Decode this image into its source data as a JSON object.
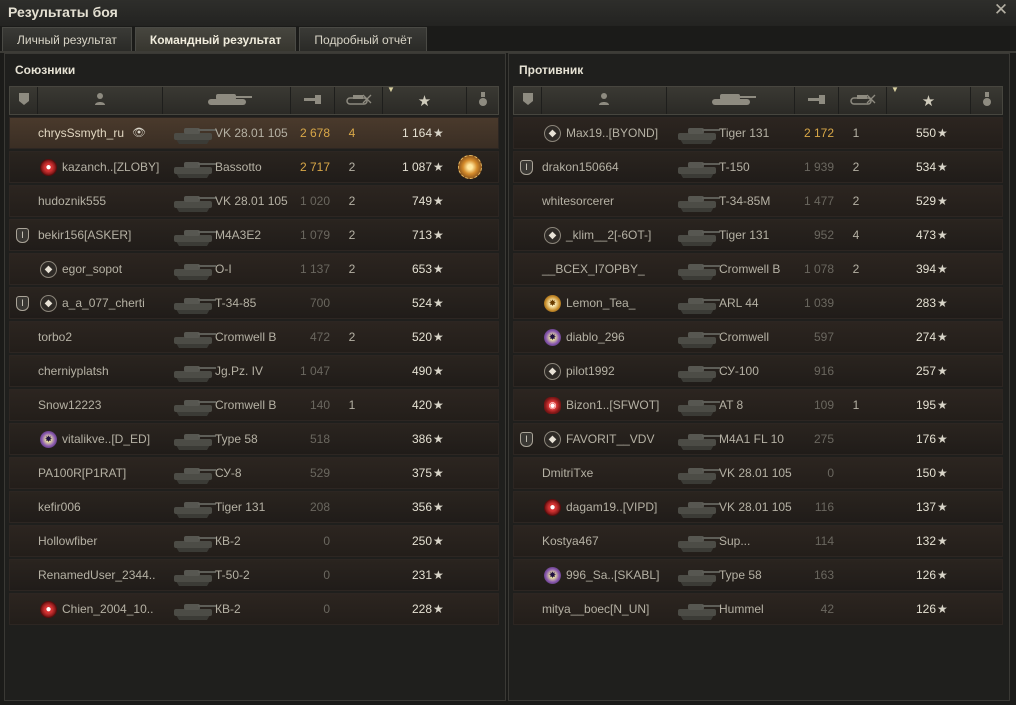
{
  "window": {
    "title": "Результаты боя",
    "close_icon": "close-icon"
  },
  "tabs": [
    {
      "label": "Личный результат",
      "active": false
    },
    {
      "label": "Командный результат",
      "active": true
    },
    {
      "label": "Подробный отчёт",
      "active": false
    }
  ],
  "columns": [
    "platoon",
    "player",
    "vehicle",
    "damage",
    "kills",
    "xp",
    "medals"
  ],
  "allies": {
    "title": "Союзники",
    "rows": [
      {
        "platoon": "",
        "badge": "",
        "name": "chrysSsmyth_ru",
        "vehicle": "VK 28.01 105",
        "damage": "2 678",
        "kills": "4",
        "xp": "1 164",
        "me": true,
        "medal": false
      },
      {
        "platoon": "",
        "badge": "red",
        "name": "kazanch..[ZLOBY]",
        "vehicle": "Bassotto",
        "damage": "2 717",
        "kills": "2",
        "xp": "1 087",
        "me": false,
        "medal": true
      },
      {
        "platoon": "",
        "badge": "",
        "name": "hudoznik555",
        "vehicle": "VK 28.01 105",
        "damage": "1 020",
        "kills": "2",
        "xp": "749",
        "me": false,
        "medal": false
      },
      {
        "platoon": "I",
        "badge": "",
        "name": "bekir156[ASKER]",
        "vehicle": "M4A3E2",
        "damage": "1 079",
        "kills": "2",
        "xp": "713",
        "me": false,
        "medal": false
      },
      {
        "platoon": "",
        "badge": "diamond",
        "name": "egor_sopot",
        "vehicle": "O-I",
        "damage": "1 137",
        "kills": "2",
        "xp": "653",
        "me": false,
        "medal": false
      },
      {
        "platoon": "I",
        "badge": "diamond",
        "name": "a_a_077_cherti",
        "vehicle": "T-34-85",
        "damage": "700",
        "kills": "",
        "xp": "524",
        "me": false,
        "medal": false
      },
      {
        "platoon": "",
        "badge": "",
        "name": "torbo2",
        "vehicle": "Cromwell B",
        "damage": "472",
        "kills": "2",
        "xp": "520",
        "me": false,
        "medal": false
      },
      {
        "platoon": "",
        "badge": "",
        "name": "cherniyplatsh",
        "vehicle": "Jg.Pz. IV",
        "damage": "1 047",
        "kills": "",
        "xp": "490",
        "me": false,
        "medal": false
      },
      {
        "platoon": "",
        "badge": "",
        "name": "Snow12223",
        "vehicle": "Cromwell B",
        "damage": "140",
        "kills": "1",
        "xp": "420",
        "me": false,
        "medal": false
      },
      {
        "platoon": "",
        "badge": "blue2",
        "name": "vitalikve..[D_ED]",
        "vehicle": "Type 58",
        "damage": "518",
        "kills": "",
        "xp": "386",
        "me": false,
        "medal": false
      },
      {
        "platoon": "",
        "badge": "",
        "name": "PA100R[P1RAT]",
        "vehicle": "СУ-8",
        "damage": "529",
        "kills": "",
        "xp": "375",
        "me": false,
        "medal": false
      },
      {
        "platoon": "",
        "badge": "",
        "name": "kefir006",
        "vehicle": "Tiger 131",
        "damage": "208",
        "kills": "",
        "xp": "356",
        "me": false,
        "medal": false
      },
      {
        "platoon": "",
        "badge": "",
        "name": "Hollowfiber",
        "vehicle": "КВ-2",
        "damage": "0",
        "kills": "",
        "xp": "250",
        "me": false,
        "medal": false
      },
      {
        "platoon": "",
        "badge": "",
        "name": "RenamedUser_2344..",
        "vehicle": "T-50-2",
        "damage": "0",
        "kills": "",
        "xp": "231",
        "me": false,
        "medal": false
      },
      {
        "platoon": "",
        "badge": "red",
        "name": "Chien_2004_10..",
        "vehicle": "КВ-2",
        "damage": "0",
        "kills": "",
        "xp": "228",
        "me": false,
        "medal": false
      }
    ]
  },
  "enemies": {
    "title": "Противник",
    "rows": [
      {
        "platoon": "",
        "badge": "diamond",
        "name": "Max19..[BYOND]",
        "vehicle": "Tiger 131",
        "damage": "2 172",
        "kills": "1",
        "xp": "550"
      },
      {
        "platoon": "I",
        "badge": "",
        "name": "drakon150664",
        "vehicle": "T-150",
        "damage": "1 939",
        "kills": "2",
        "xp": "534"
      },
      {
        "platoon": "",
        "badge": "",
        "name": "whitesorcerer",
        "vehicle": "T-34-85M",
        "damage": "1 477",
        "kills": "2",
        "xp": "529"
      },
      {
        "platoon": "",
        "badge": "diamond",
        "name": "_klim__2[-6OT-]",
        "vehicle": "Tiger 131",
        "damage": "952",
        "kills": "4",
        "xp": "473"
      },
      {
        "platoon": "",
        "badge": "",
        "name": "__BCEX_I7OPBY_",
        "vehicle": "Cromwell B",
        "damage": "1 078",
        "kills": "2",
        "xp": "394"
      },
      {
        "platoon": "",
        "badge": "star",
        "name": "Lemon_Tea_",
        "vehicle": "ARL 44",
        "damage": "1 039",
        "kills": "",
        "xp": "283"
      },
      {
        "platoon": "",
        "badge": "blue2",
        "name": "diablo_296",
        "vehicle": "Cromwell",
        "damage": "597",
        "kills": "",
        "xp": "274"
      },
      {
        "platoon": "",
        "badge": "diamond",
        "name": "pilot1992",
        "vehicle": "СУ-100",
        "damage": "916",
        "kills": "",
        "xp": "257"
      },
      {
        "platoon": "",
        "badge": "redeye",
        "name": "Bizon1..[SFWOT]",
        "vehicle": "AT 8",
        "damage": "109",
        "kills": "1",
        "xp": "195"
      },
      {
        "platoon": "I",
        "badge": "diamond",
        "name": "FAVORIT__VDV",
        "vehicle": "M4A1 FL 10",
        "damage": "275",
        "kills": "",
        "xp": "176"
      },
      {
        "platoon": "",
        "badge": "",
        "name": "DmitriTxe",
        "vehicle": "VK 28.01 105",
        "damage": "0",
        "kills": "",
        "xp": "150"
      },
      {
        "platoon": "",
        "badge": "red",
        "name": "dagam19..[VIPD]",
        "vehicle": "VK 28.01 105",
        "damage": "116",
        "kills": "",
        "xp": "137"
      },
      {
        "platoon": "",
        "badge": "",
        "name": "Kostya467",
        "vehicle": "Sup...",
        "damage": "114",
        "kills": "",
        "xp": "132"
      },
      {
        "platoon": "",
        "badge": "blue2",
        "name": "996_Sa..[SKABL]",
        "vehicle": "Type 58",
        "damage": "163",
        "kills": "",
        "xp": "126"
      },
      {
        "platoon": "",
        "badge": "",
        "name": "mitya__boec[N_UN]",
        "vehicle": "Hummel",
        "damage": "42",
        "kills": "",
        "xp": "126"
      }
    ]
  }
}
